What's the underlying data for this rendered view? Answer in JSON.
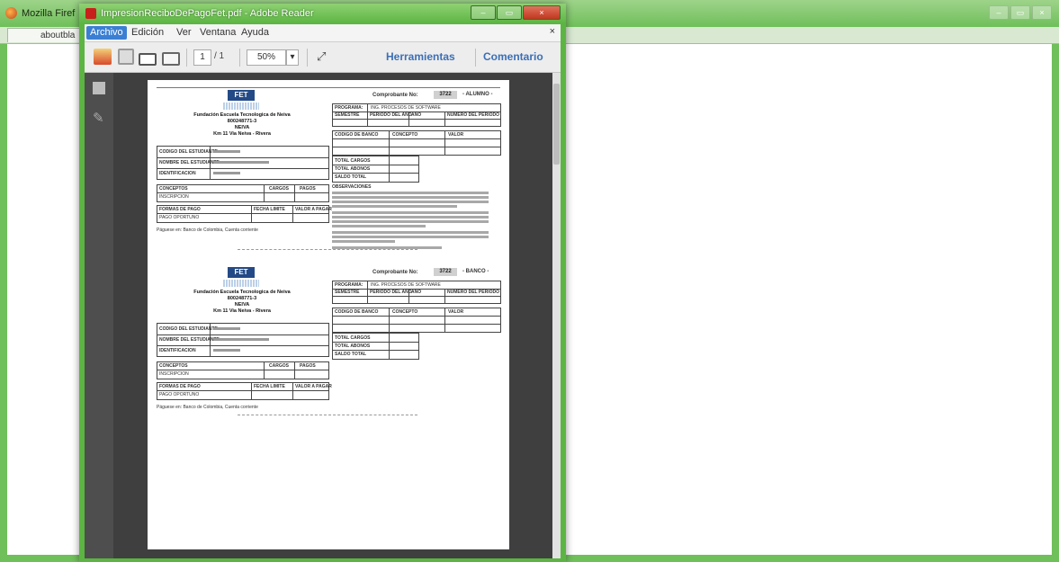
{
  "firefox": {
    "title": "Mozilla Firef",
    "tab_label": "aboutbla",
    "controls": [
      "–",
      "▭",
      "×"
    ]
  },
  "reader": {
    "title": "ImpresionReciboDePagoFet.pdf - Adobe Reader",
    "menu": [
      "Archivo",
      "Edición",
      "Ver",
      "Ventana",
      "Ayuda"
    ],
    "menu_close": "×",
    "toolbar": {
      "page_current": "1",
      "page_total": "/ 1",
      "zoom": "50%",
      "tools_label": "Herramientas",
      "comment_label": "Comentario"
    }
  },
  "receipt": {
    "logo_text": "FET",
    "institution_name": "Fundación Escuela Tecnologica de Neiva",
    "nit": "800248771-3",
    "city": "NEIVA",
    "address": "Km 11 Via Neiva - Rivera",
    "copies": [
      {
        "label": "Comprobante No:",
        "number": "3722",
        "copy_type": "- ALUMNO -",
        "program_label": "PROGRAMA:",
        "program_value": "ING. PROCESOS DE SOFTWARE",
        "header_cols": [
          "SEMESTRE",
          "PERIODO DEL AÑO",
          "AÑO",
          "NUMERO DEL PERIODO"
        ],
        "student_rows": [
          "CODIGO DEL ESTUDIANTE",
          "NOMBRE DEL ESTUDIANTE",
          "IDENTIFICACION"
        ],
        "concept_cols": [
          "CONCEPTOS",
          "CARGOS",
          "PAGOS"
        ],
        "concept_value": "INSCRIPCION",
        "payment_cols": [
          "FORMAS DE PAGO",
          "FECHA LIMITE",
          "VALOR A PAGAR"
        ],
        "payment_value": "PAGO OPORTUNO",
        "code_cols": [
          "CODIGO DE BANCO",
          "CONCEPTO",
          "VALOR"
        ],
        "totals": [
          "TOTAL CARGOS",
          "TOTAL ABONOS",
          "SALDO TOTAL"
        ],
        "observations": "OBSERVACIONES",
        "footer": "Páguese en: Banco de Colombia, Cuenta corriente"
      },
      {
        "label": "Comprobante No:",
        "number": "3722",
        "copy_type": "- BANCO -",
        "program_label": "PROGRAMA:",
        "program_value": "ING. PROCESOS DE SOFTWARE",
        "header_cols": [
          "SEMESTRE",
          "PERIODO DEL AÑO",
          "AÑO",
          "NUMERO DEL PERIODO"
        ],
        "student_rows": [
          "CODIGO DEL ESTUDIANTE",
          "NOMBRE DEL ESTUDIANTE",
          "IDENTIFICACION"
        ],
        "concept_cols": [
          "CONCEPTOS",
          "CARGOS",
          "PAGOS"
        ],
        "concept_value": "INSCRIPCION",
        "payment_cols": [
          "FORMAS DE PAGO",
          "FECHA LIMITE",
          "VALOR A PAGAR"
        ],
        "payment_value": "PAGO OPORTUNO",
        "code_cols": [
          "CODIGO DE BANCO",
          "CONCEPTO",
          "VALOR"
        ],
        "totals": [
          "TOTAL CARGOS",
          "TOTAL ABONOS",
          "SALDO TOTAL"
        ],
        "footer": "Páguese en: Banco de Colombia, Cuenta corriente"
      }
    ]
  }
}
